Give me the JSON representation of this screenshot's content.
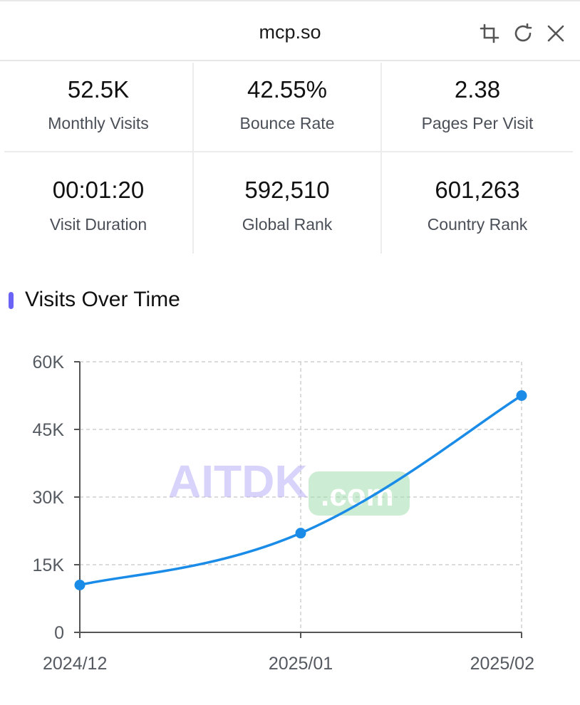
{
  "header": {
    "title": "mcp.so",
    "icons": [
      "crop-icon",
      "refresh-icon",
      "close-icon"
    ]
  },
  "stats": [
    {
      "value": "52.5K",
      "label": "Monthly Visits"
    },
    {
      "value": "42.55%",
      "label": "Bounce Rate"
    },
    {
      "value": "2.38",
      "label": "Pages Per Visit"
    },
    {
      "value": "00:01:20",
      "label": "Visit Duration"
    },
    {
      "value": "592,510",
      "label": "Global Rank"
    },
    {
      "value": "601,263",
      "label": "Country Rank"
    }
  ],
  "section": {
    "title": "Visits Over Time",
    "accent_color": "#6a63f6"
  },
  "chart_data": {
    "type": "line",
    "categories": [
      "2024/12",
      "2025/01",
      "2025/02"
    ],
    "values": [
      10500,
      22000,
      52500
    ],
    "ylim": [
      0,
      60000
    ],
    "y_ticks": [
      "0",
      "15K",
      "30K",
      "45K",
      "60K"
    ],
    "grid": true,
    "line_color": "#1a8ce8"
  },
  "watermark": {
    "main": "AITDK",
    "suffix": ".com"
  }
}
